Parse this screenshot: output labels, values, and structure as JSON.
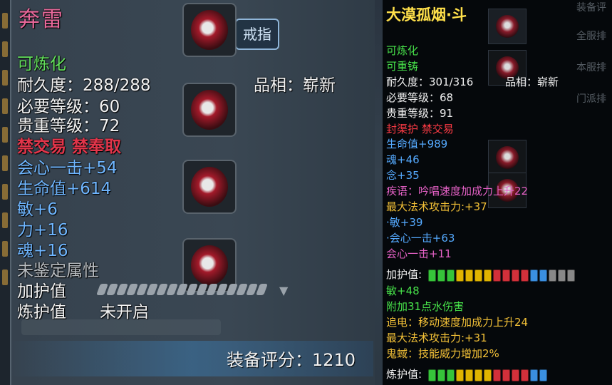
{
  "left": {
    "title": "奔雷",
    "slot_tag": "戒指",
    "lines": {
      "refinable": "可炼化",
      "durability": "耐久度：288/288",
      "appearance": "品相：崭新",
      "level_req": "必要等级：60",
      "value_level": "贵重等级：72",
      "restriction": "禁交易 禁奉取",
      "crit": "会心一击+54",
      "hp": "生命值+614",
      "agi": "敏+6",
      "str": "力+16",
      "soul": "魂+16",
      "unidentified": "未鉴定属性",
      "guard_label": "加护值",
      "refine_guard_label": "炼护值",
      "refine_guard_value": "未开启",
      "score": "装备评分：1210"
    }
  },
  "right": {
    "title": "大漠孤烟·斗",
    "faded_menu": [
      "装备评",
      "全服排",
      "本服排",
      "门派排"
    ],
    "lines": {
      "refinable": "可炼化",
      "recastable": "可重铸",
      "durability": "耐久度：301/316",
      "appearance": "品相：崭新",
      "level_req": "必要等级：68",
      "value_level": "贵重等级：91",
      "restriction": "封渠护 禁交易",
      "hp": "生命值+989",
      "soul": "魂+46",
      "mind": "念+35",
      "skill1": "疾语：吟唱速度加成力上升22",
      "magic_atk1": "最大法术攻击力:+37",
      "agi": "·敏+39",
      "crit1": "·会心一击+63",
      "crit2": "会心一击+11",
      "guard_label": "加护值:",
      "agi2": "敏+48",
      "water_dmg": "附加31点水伤害",
      "skill2": "追电：移动速度加成力上升24",
      "magic_atk2": "最大法术攻击力:+31",
      "skill3": "鬼蜮：技能威力增加2%",
      "refine_guard_label": "炼护值:"
    },
    "guard_gems": [
      "#36c43a",
      "#36c43a",
      "#36c43a",
      "#e0b400",
      "#e0b400",
      "#e0b400",
      "#e0b400",
      "#d2303a",
      "#d2303a",
      "#d2303a",
      "#d2303a",
      "#3a8fe0",
      "#3a8fe0",
      "#888888",
      "#888888",
      "#888888"
    ],
    "refine_gems": [
      "#36c43a",
      "#36c43a",
      "#36c43a",
      "#e0b400",
      "#e0b400",
      "#e0b400",
      "#e0b400",
      "#d2303a",
      "#d2303a",
      "#d2303a",
      "#d2303a",
      "#3a8fe0",
      "#3a8fe0"
    ]
  },
  "colors": {
    "title_pink": "#e8689a",
    "title_gold": "#ffe04a",
    "stat_green": "#63e05c",
    "stat_blue": "#6fb6ff",
    "warn_red": "#e2354a"
  }
}
